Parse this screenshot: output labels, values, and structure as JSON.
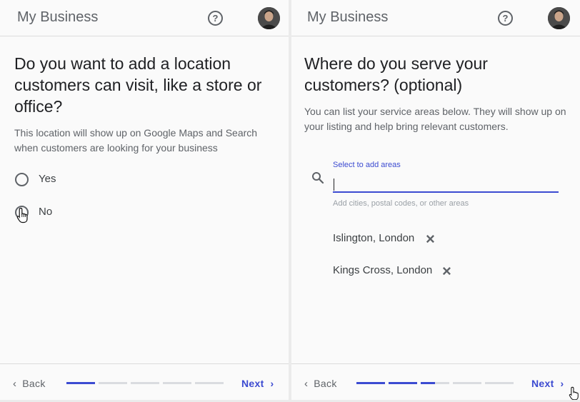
{
  "colors": {
    "accent": "#3c4bd1",
    "text_primary": "#202124",
    "text_secondary": "#5f6368",
    "divider": "#dcdcdc",
    "progress_inactive": "#dadce0"
  },
  "left": {
    "app_title": "My Business",
    "help_icon": "help-circle-icon",
    "help_glyph": "?",
    "heading": "Do you want to add a location customers can visit, like a store or office?",
    "description": "This location will show up on Google Maps and Search when customers are looking for your business",
    "options": [
      {
        "label": "Yes",
        "selected": false
      },
      {
        "label": "No",
        "selected": false
      }
    ],
    "footer": {
      "back_label": "Back",
      "back_icon": "chevron-left-icon",
      "next_label": "Next",
      "next_icon": "chevron-right-icon",
      "progress": [
        1,
        0,
        0,
        0,
        0
      ]
    },
    "pointer_icon": "hand-pointer-icon"
  },
  "right": {
    "app_title": "My Business",
    "help_icon": "help-circle-icon",
    "help_glyph": "?",
    "heading": "Where do you serve your customers? (optional)",
    "description": "You can list your service areas below. They will show up on your listing and help bring relevant customers.",
    "search": {
      "label": "Select to add areas",
      "value": "",
      "helper": "Add cities, postal codes, or other areas",
      "icon": "search-icon"
    },
    "areas": [
      {
        "label": "Islington, London",
        "remove_icon": "close-icon"
      },
      {
        "label": "Kings Cross, London",
        "remove_icon": "close-icon"
      }
    ],
    "footer": {
      "back_label": "Back",
      "back_icon": "chevron-left-icon",
      "next_label": "Next",
      "next_icon": "chevron-right-icon",
      "progress": [
        1,
        1,
        0.5,
        0,
        0
      ]
    },
    "pointer_icon": "hand-pointer-icon"
  }
}
